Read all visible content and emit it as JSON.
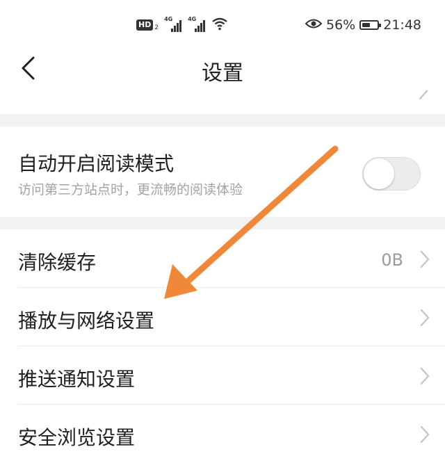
{
  "status_bar": {
    "hd_label": "HD",
    "hd_sub": "2",
    "signal1_label": "4G",
    "signal2_label": "4G",
    "battery_percent": "56%",
    "battery_level": 0.56,
    "time": "21:48",
    "icons": [
      "signal-icon",
      "wifi-icon",
      "eye-icon",
      "battery-icon"
    ]
  },
  "nav": {
    "title": "设置",
    "back_icon": "chevron-left-icon"
  },
  "reading_mode": {
    "title": "自动开启阅读模式",
    "subtitle": "访问第三方站点时，更流畅的阅读体验",
    "enabled": false
  },
  "menu_items": [
    {
      "label": "清除缓存",
      "value": "0B"
    },
    {
      "label": "播放与网络设置",
      "value": ""
    },
    {
      "label": "推送通知设置",
      "value": ""
    },
    {
      "label": "安全浏览设置",
      "value": ""
    }
  ],
  "colors": {
    "annotation_arrow": "#f0883a",
    "section_gap": "#f2f2f2",
    "secondary_text": "#a3a3a3"
  }
}
